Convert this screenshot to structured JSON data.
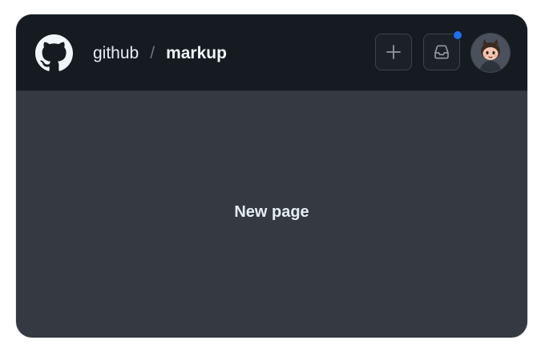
{
  "header": {
    "breadcrumb": {
      "owner": "github",
      "separator": "/",
      "repo": "markup"
    },
    "icons": {
      "logo": "github-mark-icon",
      "create": "plus-icon",
      "inbox": "inbox-icon",
      "avatar": "octocat-avatar"
    },
    "notification_dot_color": "#1f6feb"
  },
  "main": {
    "text": "New page"
  },
  "colors": {
    "header_bg": "#161b22",
    "body_bg": "#343942",
    "text": "#e6edf3"
  }
}
